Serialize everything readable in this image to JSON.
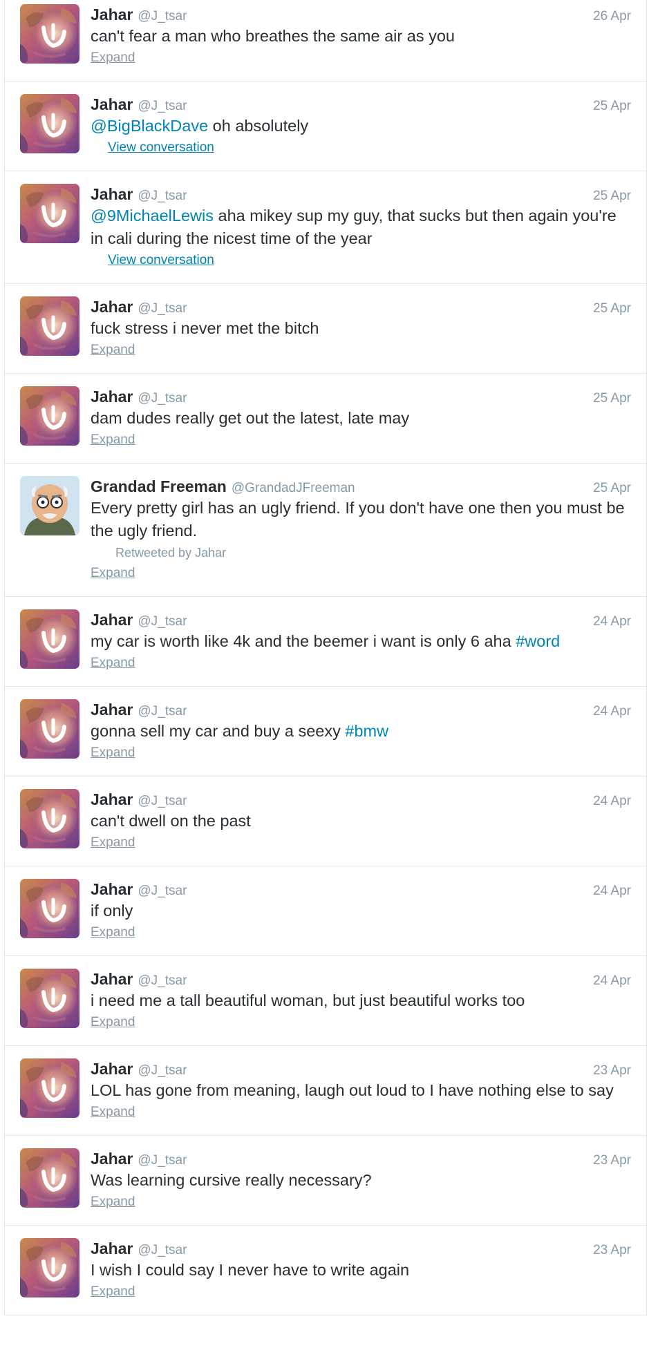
{
  "tweets": [
    {
      "name": "Jahar",
      "handle": "@J_tsar",
      "date": "26 Apr",
      "avatar": "jahar",
      "segments": [
        {
          "t": "can't fear a man who breathes the same air as you"
        }
      ],
      "action": "Expand"
    },
    {
      "name": "Jahar",
      "handle": "@J_tsar",
      "date": "25 Apr",
      "avatar": "jahar",
      "segments": [
        {
          "t": "@BigBlackDave",
          "link": true
        },
        {
          "t": " oh absolutely"
        }
      ],
      "action": "View conversation",
      "action_type": "conversation"
    },
    {
      "name": "Jahar",
      "handle": "@J_tsar",
      "date": "25 Apr",
      "avatar": "jahar",
      "segments": [
        {
          "t": "@9MichaelLewis",
          "link": true
        },
        {
          "t": " aha mikey sup my guy, that sucks but then again you're in cali during the nicest time of the year"
        }
      ],
      "action": "View conversation",
      "action_type": "conversation"
    },
    {
      "name": "Jahar",
      "handle": "@J_tsar",
      "date": "25 Apr",
      "avatar": "jahar",
      "segments": [
        {
          "t": "fuck stress i never met the bitch"
        }
      ],
      "action": "Expand"
    },
    {
      "name": "Jahar",
      "handle": "@J_tsar",
      "date": "25 Apr",
      "avatar": "jahar",
      "segments": [
        {
          "t": "dam dudes really get out the latest, late may"
        }
      ],
      "action": "Expand"
    },
    {
      "name": "Grandad Freeman",
      "handle": "@GrandadJFreeman",
      "date": "25 Apr",
      "avatar": "grandad",
      "segments": [
        {
          "t": "Every pretty girl has an ugly friend. If you don't have one then you must be the ugly friend."
        }
      ],
      "retweeted_by": "Retweeted by Jahar",
      "action": "Expand"
    },
    {
      "name": "Jahar",
      "handle": "@J_tsar",
      "date": "24 Apr",
      "avatar": "jahar",
      "segments": [
        {
          "t": "my car is worth like 4k and the beemer i want is only 6 aha "
        },
        {
          "t": "#word",
          "link": true
        }
      ],
      "action": "Expand"
    },
    {
      "name": "Jahar",
      "handle": "@J_tsar",
      "date": "24 Apr",
      "avatar": "jahar",
      "segments": [
        {
          "t": "gonna sell my car and buy a seexy "
        },
        {
          "t": "#bmw",
          "link": true
        }
      ],
      "action": "Expand"
    },
    {
      "name": "Jahar",
      "handle": "@J_tsar",
      "date": "24 Apr",
      "avatar": "jahar",
      "segments": [
        {
          "t": "can't dwell on the past"
        }
      ],
      "action": "Expand"
    },
    {
      "name": "Jahar",
      "handle": "@J_tsar",
      "date": "24 Apr",
      "avatar": "jahar",
      "segments": [
        {
          "t": "if only"
        }
      ],
      "action": "Expand"
    },
    {
      "name": "Jahar",
      "handle": "@J_tsar",
      "date": "24 Apr",
      "avatar": "jahar",
      "segments": [
        {
          "t": "i need me a tall beautiful woman, but just beautiful works too"
        }
      ],
      "action": "Expand"
    },
    {
      "name": "Jahar",
      "handle": "@J_tsar",
      "date": "23 Apr",
      "avatar": "jahar",
      "segments": [
        {
          "t": "LOL has gone from meaning, laugh out loud to I have nothing else to say"
        }
      ],
      "action": "Expand"
    },
    {
      "name": "Jahar",
      "handle": "@J_tsar",
      "date": "23 Apr",
      "avatar": "jahar",
      "segments": [
        {
          "t": "Was learning cursive really necessary?"
        }
      ],
      "action": "Expand"
    },
    {
      "name": "Jahar",
      "handle": "@J_tsar",
      "date": "23 Apr",
      "avatar": "jahar",
      "segments": [
        {
          "t": "I wish I could say I never have to write again"
        }
      ],
      "action": "Expand"
    }
  ],
  "colors": {
    "link": "#0084b4",
    "muted": "#8899a6",
    "text": "#292f33",
    "border": "#e1e8ed"
  }
}
